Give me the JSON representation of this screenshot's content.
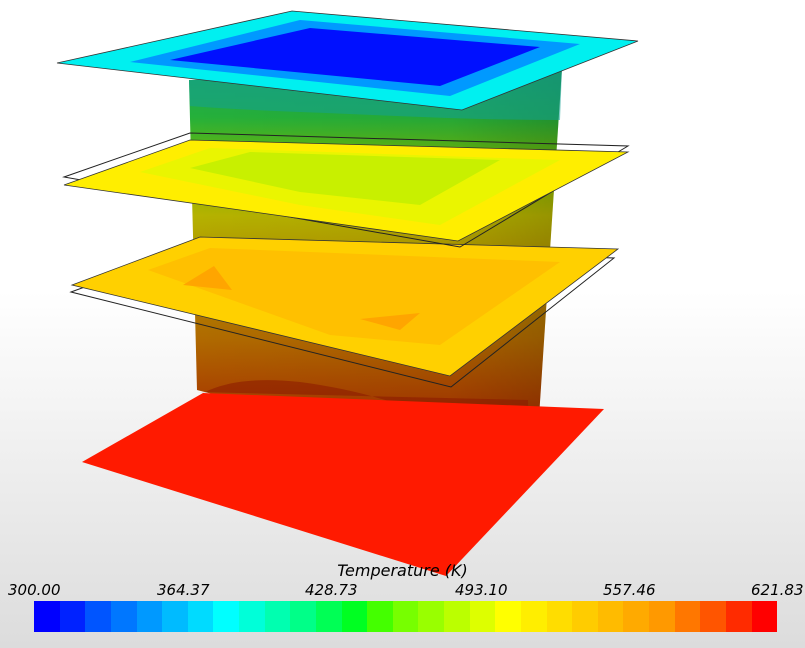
{
  "legend": {
    "title": "Temperature (K)",
    "ticks": [
      "300.00",
      "364.37",
      "428.73",
      "493.10",
      "557.46",
      "621.83"
    ],
    "min": 300.0,
    "max": 621.83,
    "colors": [
      "#0000ff",
      "#0022ff",
      "#0055ff",
      "#0077ff",
      "#0099ff",
      "#00bbff",
      "#00dbff",
      "#00ffff",
      "#00ffd9",
      "#00ffb0",
      "#00ff88",
      "#00ff55",
      "#00ff22",
      "#44ff00",
      "#77ff00",
      "#99ff00",
      "#bbff00",
      "#ddff00",
      "#ffff00",
      "#ffee00",
      "#ffdd00",
      "#ffcc00",
      "#ffbb00",
      "#ffaa00",
      "#ff9900",
      "#ff7700",
      "#ff5500",
      "#ff2b00",
      "#ff0000"
    ]
  }
}
